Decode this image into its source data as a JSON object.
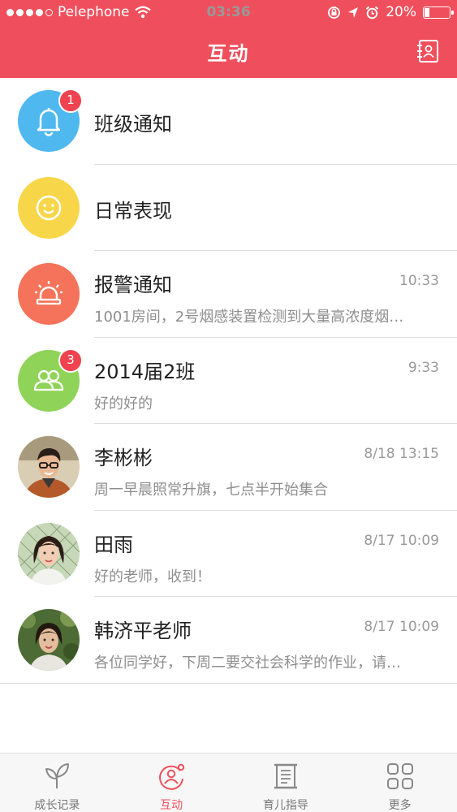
{
  "status_bar": {
    "carrier": "Pelephone",
    "time": "03:36",
    "battery": "20%",
    "battery_level": 0.2,
    "signal_bars_filled": 4,
    "signal_bars_total": 5
  },
  "nav": {
    "title": "互动",
    "right_icon": "contacts-icon"
  },
  "theme": {
    "accent": "#ef4f5c",
    "badge": "#ef4350"
  },
  "conversations": [
    {
      "name": "班级通知",
      "icon": "bell-icon",
      "icon_bg": "#4fb8ef",
      "badge": "1",
      "time": "",
      "preview": ""
    },
    {
      "name": "日常表现",
      "icon": "smiley-icon",
      "icon_bg": "#f7d64a",
      "badge": "",
      "time": "",
      "preview": ""
    },
    {
      "name": "报警通知",
      "icon": "alarm-light-icon",
      "icon_bg": "#f5735a",
      "badge": "",
      "time": "10:33",
      "preview": "1001房间，2号烟感装置检测到大量高浓度烟…"
    },
    {
      "name": "2014届2班",
      "icon": "group-icon",
      "icon_bg": "#8fd458",
      "badge": "3",
      "time": "9:33",
      "preview": "好的好的"
    },
    {
      "name": "李彬彬",
      "icon": "avatar-photo",
      "icon_bg": "#9b7a5a",
      "badge": "",
      "time": "8/18  13:15",
      "preview": "周一早晨照常升旗，七点半开始集合"
    },
    {
      "name": "田雨",
      "icon": "avatar-photo",
      "icon_bg": "#7fa86a",
      "badge": "",
      "time": "8/17  10:09",
      "preview": "好的老师，收到！"
    },
    {
      "name": "韩济平老师",
      "icon": "avatar-photo",
      "icon_bg": "#5e7a3e",
      "badge": "",
      "time": "8/17  10:09",
      "preview": "各位同学好，下周二要交社会科学的作业，请…"
    }
  ],
  "tabs": [
    {
      "label": "成长记录",
      "icon": "sprout-icon",
      "active": false
    },
    {
      "label": "互动",
      "icon": "interaction-icon",
      "active": true
    },
    {
      "label": "育儿指导",
      "icon": "scroll-icon",
      "active": false
    },
    {
      "label": "更多",
      "icon": "grid-icon",
      "active": false
    }
  ]
}
